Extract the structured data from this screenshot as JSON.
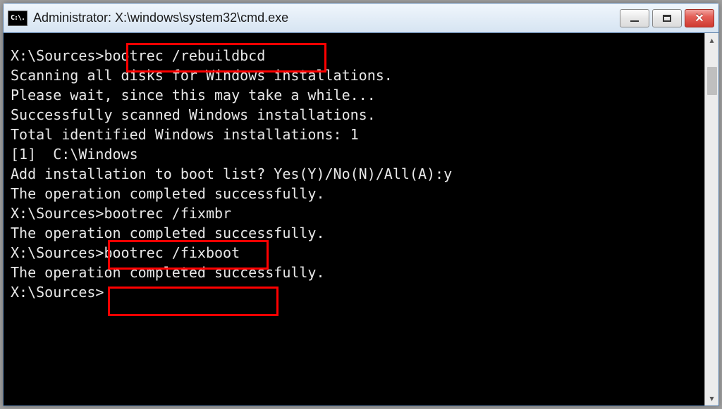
{
  "window": {
    "icon_glyph": "C:\\.",
    "title": "Administrator: X:\\windows\\system32\\cmd.exe"
  },
  "terminal": {
    "lines": [
      {
        "prompt": "X:\\Sources>",
        "cmd": "bootrec /rebuildbcd"
      },
      {
        "text": "Scanning all disks for Windows installations."
      },
      {
        "text": ""
      },
      {
        "text": "Please wait, since this may take a while..."
      },
      {
        "text": ""
      },
      {
        "text": "Successfully scanned Windows installations."
      },
      {
        "text": "Total identified Windows installations: 1"
      },
      {
        "text": "[1]  C:\\Windows"
      },
      {
        "text": "Add installation to boot list? Yes(Y)/No(N)/All(A):y"
      },
      {
        "text": "The operation completed successfully."
      },
      {
        "text": ""
      },
      {
        "prompt": "X:\\Sources>",
        "cmd": "bootrec /fixmbr"
      },
      {
        "text": "The operation completed successfully."
      },
      {
        "text": ""
      },
      {
        "prompt": "X:\\Sources>",
        "cmd": "bootrec /fixboot"
      },
      {
        "text": "The operation completed successfully."
      },
      {
        "text": ""
      },
      {
        "prompt": "X:\\Sources>",
        "cmd": ""
      }
    ]
  }
}
